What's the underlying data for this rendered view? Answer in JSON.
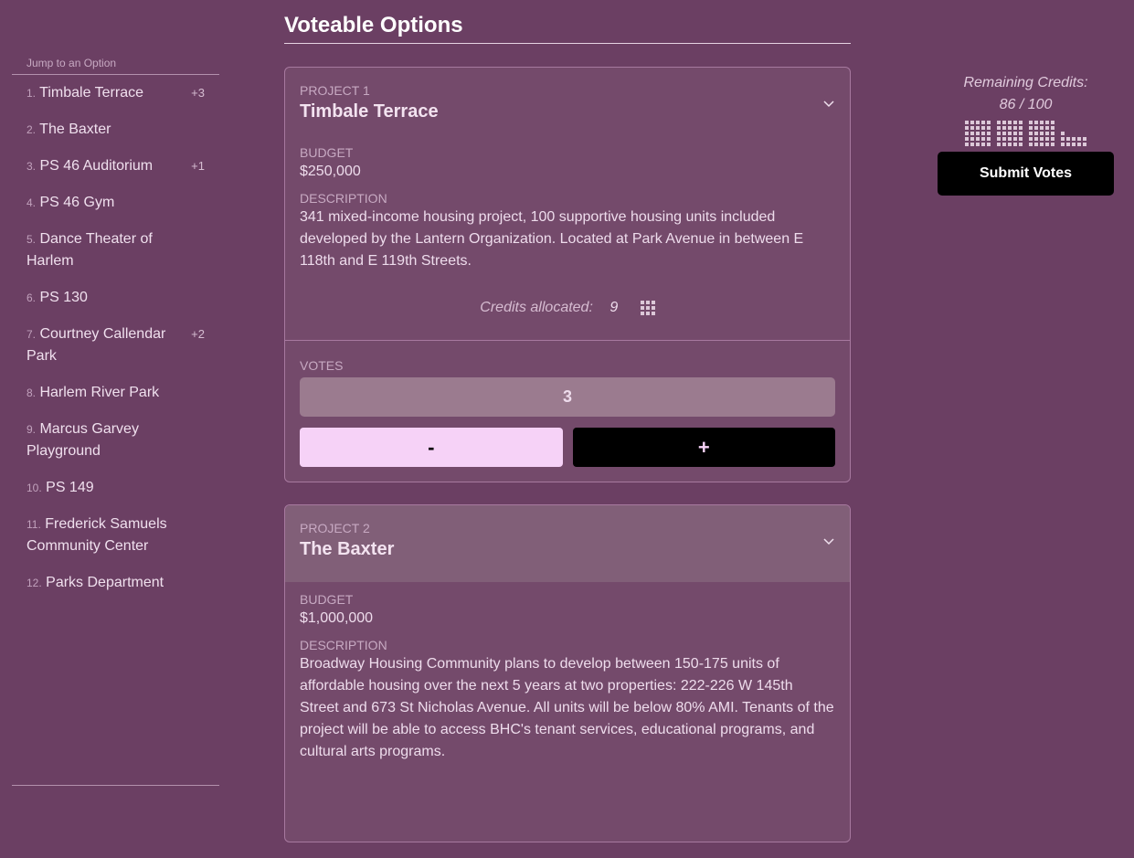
{
  "sidebar": {
    "header": "Jump to an Option",
    "items": [
      {
        "num": "1.",
        "label": "Timbale Terrace",
        "badge": "+3"
      },
      {
        "num": "2.",
        "label": "The Baxter",
        "badge": ""
      },
      {
        "num": "3.",
        "label": "PS 46 Auditorium",
        "badge": "+1"
      },
      {
        "num": "4.",
        "label": "PS 46 Gym",
        "badge": ""
      },
      {
        "num": "5.",
        "label": "Dance Theater of Harlem",
        "badge": ""
      },
      {
        "num": "6.",
        "label": "PS 130",
        "badge": ""
      },
      {
        "num": "7.",
        "label": "Courtney Callendar Park",
        "badge": "+2"
      },
      {
        "num": "8.",
        "label": "Harlem River Park",
        "badge": ""
      },
      {
        "num": "9.",
        "label": "Marcus Garvey Playground",
        "badge": ""
      },
      {
        "num": "10.",
        "label": "PS 149",
        "badge": ""
      },
      {
        "num": "11.",
        "label": "Frederick Samuels Community Center",
        "badge": ""
      },
      {
        "num": "12.",
        "label": "Parks Department",
        "badge": ""
      }
    ]
  },
  "main": {
    "title": "Voteable Options",
    "projects": [
      {
        "number_label": "PROJECT 1",
        "name": "Timbale Terrace",
        "budget_label": "BUDGET",
        "budget": "$250,000",
        "description_label": "DESCRIPTION",
        "description": "341 mixed-income housing project, 100 supportive housing units included developed by the Lantern Organization. Located at Park Avenue in between E 118th and E 119th Streets.",
        "credits_label": "Credits allocated:",
        "credits_allocated": "9",
        "votes_label": "VOTES",
        "votes": "3",
        "minus_label": "-",
        "plus_label": "+"
      },
      {
        "number_label": "PROJECT 2",
        "name": "The Baxter",
        "budget_label": "BUDGET",
        "budget": "$1,000,000",
        "description_label": "DESCRIPTION",
        "description": "Broadway Housing Community plans to develop between 150-175 units of affordable housing over the next 5 years at two properties: 222-226 W 145th Street and 673 St Nicholas Avenue. All units will be below 80% AMI. Tenants of the project will be able to access BHC's tenant services, educational programs, and cultural arts programs."
      }
    ]
  },
  "credits": {
    "label": "Remaining Credits:",
    "remaining": 86,
    "total": 100,
    "display": "86  / 100",
    "submit_label": "Submit Votes"
  },
  "colors": {
    "background": "#6b3f63",
    "card": "#744a6b",
    "accent_pink": "#f6d2f7",
    "button_dark": "#000000"
  }
}
